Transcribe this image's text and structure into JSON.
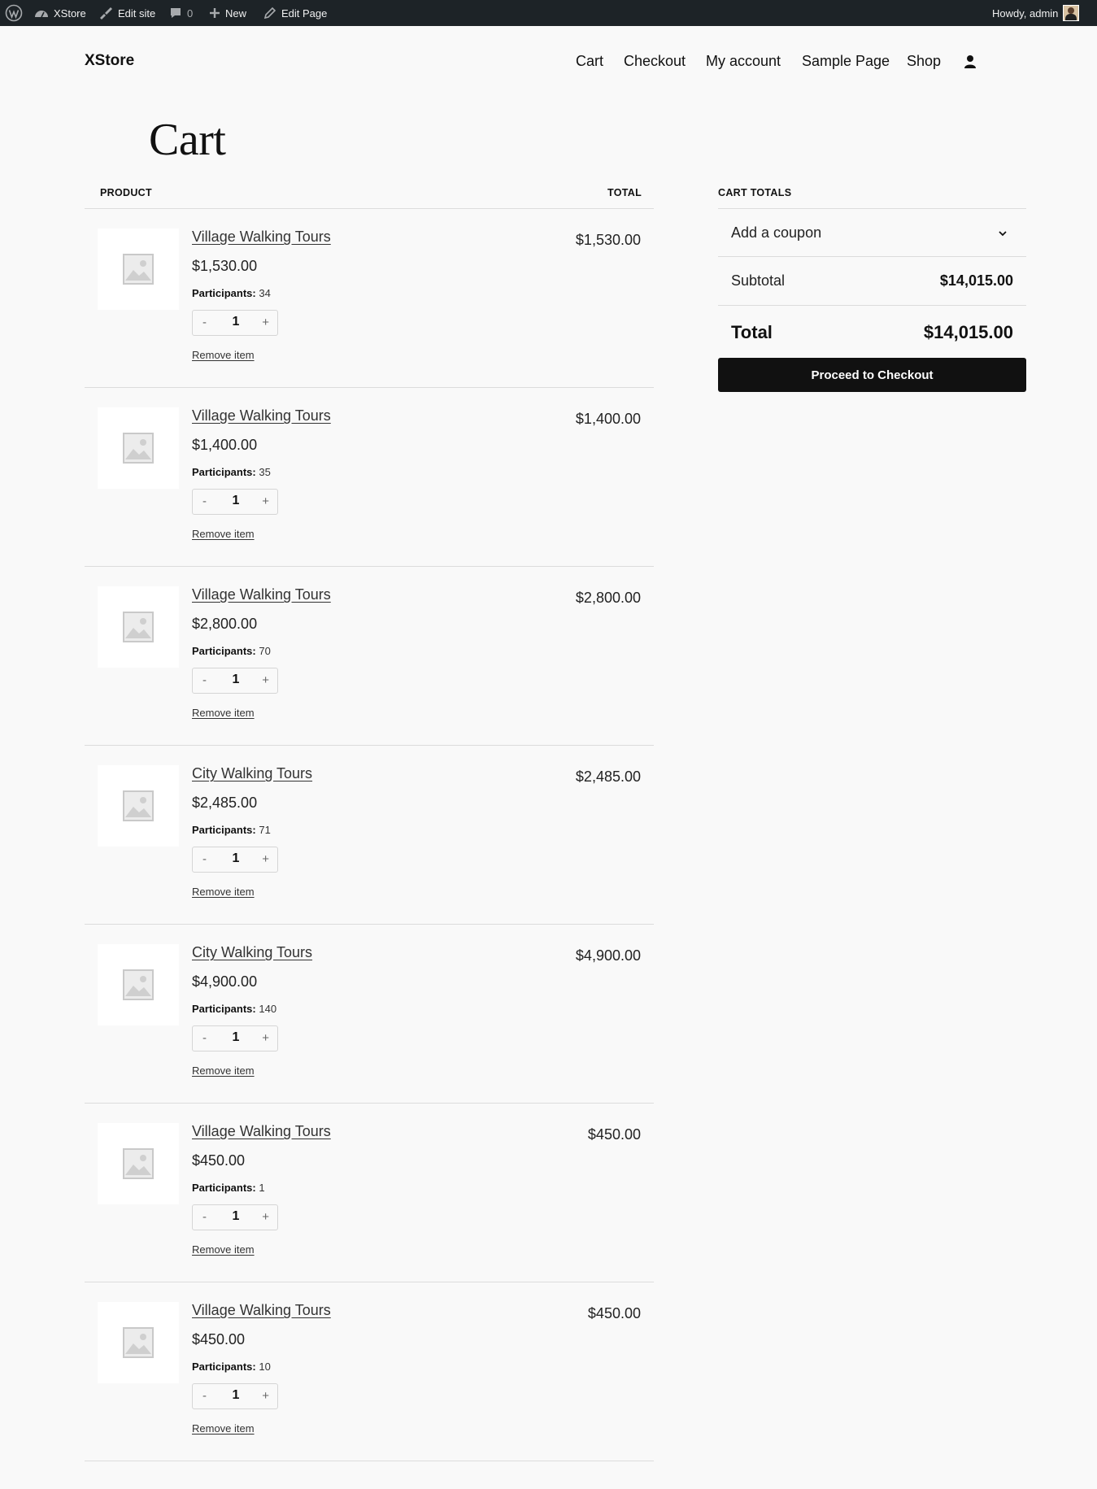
{
  "admin_bar": {
    "site": "XStore",
    "edit_site": "Edit site",
    "comments_count": "0",
    "new": "New",
    "edit_page": "Edit Page",
    "howdy": "Howdy, admin"
  },
  "header": {
    "site_title": "XStore",
    "nav": [
      "Cart",
      "Checkout",
      "My account",
      "Sample Page",
      "Shop"
    ]
  },
  "page_title": "Cart",
  "table": {
    "product_header": "PRODUCT",
    "total_header": "TOTAL"
  },
  "items": [
    {
      "name": "Village Walking Tours",
      "price": "$1,530.00",
      "meta_label": "Participants:",
      "meta_value": "34",
      "qty": "1",
      "total": "$1,530.00",
      "remove": "Remove item"
    },
    {
      "name": "Village Walking Tours",
      "price": "$1,400.00",
      "meta_label": "Participants:",
      "meta_value": "35",
      "qty": "1",
      "total": "$1,400.00",
      "remove": "Remove item"
    },
    {
      "name": "Village Walking Tours",
      "price": "$2,800.00",
      "meta_label": "Participants:",
      "meta_value": "70",
      "qty": "1",
      "total": "$2,800.00",
      "remove": "Remove item"
    },
    {
      "name": "City Walking Tours",
      "price": "$2,485.00",
      "meta_label": "Participants:",
      "meta_value": "71",
      "qty": "1",
      "total": "$2,485.00",
      "remove": "Remove item"
    },
    {
      "name": "City Walking Tours",
      "price": "$4,900.00",
      "meta_label": "Participants:",
      "meta_value": "140",
      "qty": "1",
      "total": "$4,900.00",
      "remove": "Remove item"
    },
    {
      "name": "Village Walking Tours",
      "price": "$450.00",
      "meta_label": "Participants:",
      "meta_value": "1",
      "qty": "1",
      "total": "$450.00",
      "remove": "Remove item"
    },
    {
      "name": "Village Walking Tours",
      "price": "$450.00",
      "meta_label": "Participants:",
      "meta_value": "10",
      "qty": "1",
      "total": "$450.00",
      "remove": "Remove item"
    }
  ],
  "qty_controls": {
    "minus": "-",
    "plus": "+"
  },
  "totals": {
    "heading": "CART TOTALS",
    "coupon": "Add a coupon",
    "subtotal_label": "Subtotal",
    "subtotal": "$14,015.00",
    "total_label": "Total",
    "total": "$14,015.00",
    "checkout_button": "Proceed to Checkout"
  },
  "icons": {
    "wordpress": "wordpress-icon",
    "dashboard": "dashboard-icon",
    "edit_site": "brush-icon",
    "comments": "comment-icon",
    "new": "plus-icon",
    "edit_page": "pencil-icon",
    "account": "user-icon",
    "coupon_toggle": "chevron-down-icon",
    "product_image": "image-placeholder-icon"
  },
  "colors": {
    "admin_bar": "#1d2327",
    "button": "#111111",
    "page_bg": "#f9f9f9"
  }
}
